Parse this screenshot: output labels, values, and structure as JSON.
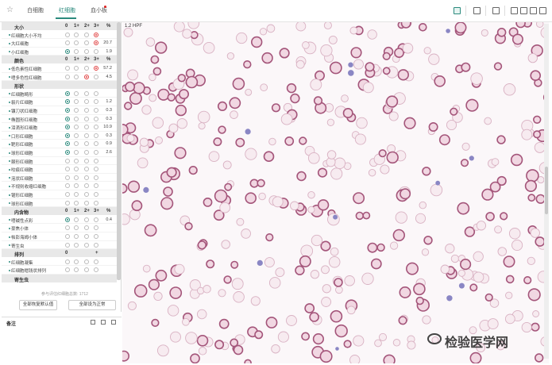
{
  "tabs": [
    {
      "label": "白细胞"
    },
    {
      "label": "红细胞"
    },
    {
      "label": "血小板"
    }
  ],
  "colors": {
    "accent": "#2b8a7d",
    "alert": "#e04040"
  },
  "panel": {
    "headers": {
      "size": "大小",
      "color": "颜色",
      "shape": "形状",
      "inclusion": "内含物",
      "arrangement": "排列",
      "parasite": "寄生虫"
    },
    "cols": {
      "c0": "0",
      "c1": "1+",
      "c2": "2+",
      "c3": "3+",
      "pct": "%"
    },
    "arrangement_value": "0",
    "arrangement_plus": "+",
    "size_rows": [
      {
        "label": "红细胞大小不均",
        "pct": ""
      },
      {
        "label": "大红细胞",
        "pct": "20.7"
      },
      {
        "label": "小红细胞",
        "pct": "1.9"
      }
    ],
    "color_rows": [
      {
        "label": "低色素性红细胞",
        "pct": "57.2"
      },
      {
        "label": "嗜多色性红细胞",
        "pct": "4.5"
      }
    ],
    "shape_rows": [
      {
        "label": "红细胞畸形",
        "pct": ""
      },
      {
        "label": "裂片红细胞",
        "pct": "1.2"
      },
      {
        "label": "镰刀状红细胞",
        "pct": "0.3"
      },
      {
        "label": "椭圆形红细胞",
        "pct": "0.3"
      },
      {
        "label": "泪滴形红细胞",
        "pct": "10.9"
      },
      {
        "label": "口形红细胞",
        "pct": "0.3"
      },
      {
        "label": "靶形红细胞",
        "pct": "0.9"
      },
      {
        "label": "球形红细胞",
        "pct": "2.6"
      },
      {
        "label": "棘形红细胞",
        "pct": ""
      },
      {
        "label": "咬痕红细胞",
        "pct": ""
      },
      {
        "label": "泡状红细胞",
        "pct": ""
      },
      {
        "label": "不规则收缩红细胞",
        "pct": ""
      },
      {
        "label": "锯形红细胞",
        "pct": ""
      },
      {
        "label": "球形红细胞",
        "pct": ""
      }
    ],
    "inclusion_rows": [
      {
        "label": "嗜碱性点彩",
        "pct": "0.4"
      },
      {
        "label": "豪焦小体",
        "pct": ""
      },
      {
        "label": "帕彭海姆小体",
        "pct": ""
      },
      {
        "label": "寄生虫",
        "pct": ""
      }
    ],
    "arrangement_rows": [
      {
        "label": "红细胞凝集",
        "pct": ""
      },
      {
        "label": "红细胞缗钱状排列",
        "pct": ""
      }
    ],
    "cell_count": "参与评估红细胞总数: 1712",
    "btn_default": "全部恢复默认值",
    "btn_normal": "全部设为正常"
  },
  "notes": {
    "title": "备注"
  },
  "view": {
    "hpf": "1.2 HPF"
  },
  "watermark": "检验医学网"
}
